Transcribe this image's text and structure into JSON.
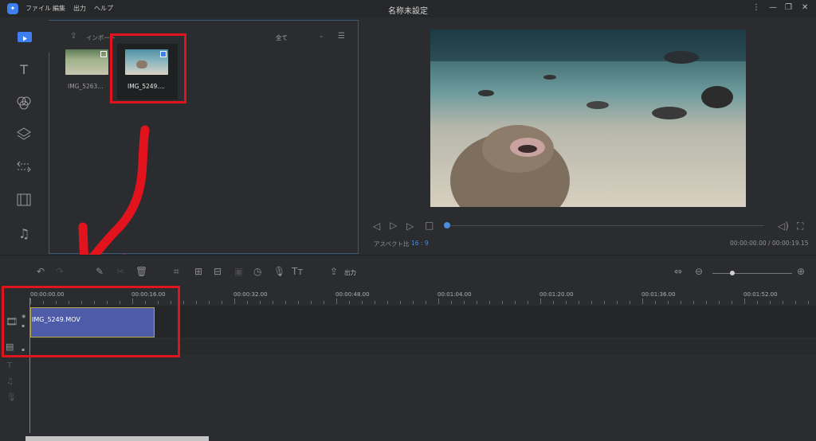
{
  "app": {
    "title": "名称未設定",
    "menu": [
      "ファイル",
      "編集",
      "出力",
      "ヘルプ"
    ]
  },
  "media": {
    "import_label": "インポート",
    "filter_label": "全て",
    "items": [
      {
        "name": "IMG_5263...",
        "selected": false
      },
      {
        "name": "IMG_5249....",
        "selected": true
      }
    ]
  },
  "player": {
    "aspect_label": "アスペクト比",
    "aspect_value": "16 : 9",
    "time_display": "00:00:00.00 / 00:00:19.15"
  },
  "toolbar": {
    "export_label": "出力"
  },
  "timeline": {
    "ruler_times": [
      "00:00:00.00",
      "00:00:16.00",
      "00:00:32.00",
      "00:00:48.00",
      "00:01:04.00",
      "00:01:20.00",
      "00:01:36.00",
      "00:01:52.00"
    ],
    "clip_label": "IMG_5249.MOV"
  },
  "colors": {
    "accent": "#4a8ee0",
    "annotation": "#e2131d",
    "clip": "#4d5ba8"
  }
}
